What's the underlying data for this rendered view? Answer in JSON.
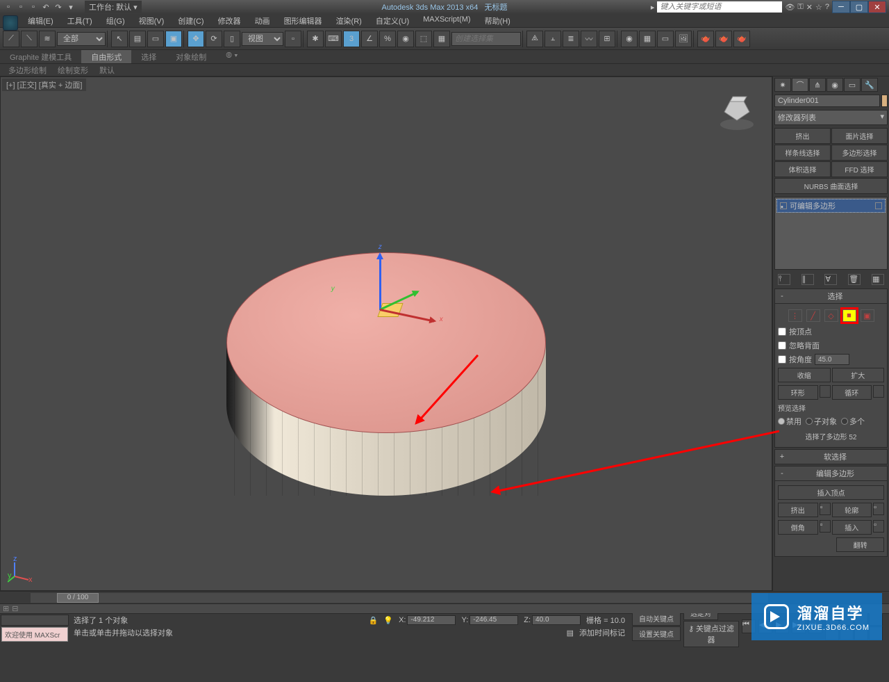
{
  "title": {
    "app": "Autodesk 3ds Max  2013 x64",
    "doc": "无标题",
    "workspace_label": "工作台: 默认",
    "search_placeholder": "键入关键字或短语"
  },
  "menu": {
    "edit": "编辑(E)",
    "tools": "工具(T)",
    "group": "组(G)",
    "views": "视图(V)",
    "create": "创建(C)",
    "modifiers": "修改器",
    "animation": "动画",
    "graph": "图形编辑器",
    "render": "渲染(R)",
    "customize": "自定义(U)",
    "maxscript": "MAXScript(M)",
    "help": "帮助(H)"
  },
  "toolbar": {
    "selfilter": "全部",
    "refcoord": "视图",
    "named_set_placeholder": "创建选择集"
  },
  "ribbon": {
    "graphite": "Graphite 建模工具",
    "freeform": "自由形式",
    "selection": "选择",
    "objpaint": "对象绘制",
    "polydraw": "多边形绘制",
    "paintdeform": "绘制变形",
    "defaults": "默认"
  },
  "viewport": {
    "label": "[+] [正交] [真实 + 边面]",
    "ax": "x",
    "ay": "y",
    "az": "z"
  },
  "panel": {
    "obj_name": "Cylinder001",
    "modlist": "修改器列表",
    "mods": {
      "extrude": "挤出",
      "facesel": "面片选择",
      "splinesel": "样条线选择",
      "polysel": "多边形选择",
      "volsel": "体积选择",
      "ffdsel": "FFD 选择",
      "nurbs": "NURBS 曲面选择"
    },
    "stack_item": "可编辑多边形",
    "rollout_sel": "选择",
    "byvertex": "按顶点",
    "ignoreback": "忽略背面",
    "byangle": "按角度",
    "angle_val": "45.0",
    "shrink": "收缩",
    "grow": "扩大",
    "ring": "环形",
    "loop": "循环",
    "preview_sel": "预览选择",
    "r_off": "禁用",
    "r_subobj": "子对象",
    "r_multi": "多个",
    "sel_status": "选择了多边形 52",
    "rollout_soft": "软选择",
    "rollout_editpoly": "编辑多边形",
    "insert_vert": "插入顶点",
    "extrude2": "挤出",
    "outline": "轮廓",
    "bevel": "倒角",
    "inset": "插入",
    "flip": "翻转"
  },
  "timeline": {
    "pos": "0 / 100"
  },
  "status": {
    "welcome": "欢迎使用  MAXScr",
    "sel_info": "选择了 1 个对象",
    "prompt": "单击或单击并拖动以选择对象",
    "xl": "X:",
    "xv": "-49.212",
    "yl": "Y:",
    "yv": "-246.45",
    "zl": "Z:",
    "zv": "40.0",
    "grid": "栅格 = 10.0",
    "addtime": "添加时间标记",
    "autokey": "自动关键点",
    "selbind": "选定对",
    "setkey": "设置关键点",
    "keyfilter": "关键点过滤器"
  },
  "watermark": {
    "main": "溜溜自学",
    "sub": "ZIXUE.3D66.COM"
  }
}
